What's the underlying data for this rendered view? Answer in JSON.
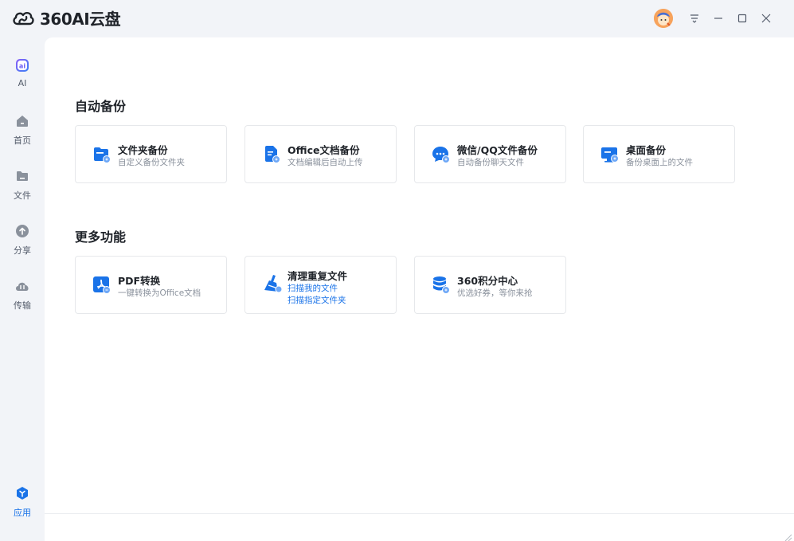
{
  "app": {
    "title": "360AI云盘"
  },
  "sidebar": {
    "items": [
      {
        "label": "AI",
        "icon": "ai-icon"
      },
      {
        "label": "首页",
        "icon": "home-icon"
      },
      {
        "label": "文件",
        "icon": "folder-icon"
      },
      {
        "label": "分享",
        "icon": "share-icon"
      },
      {
        "label": "传输",
        "icon": "transfer-icon"
      }
    ],
    "bottom_item": {
      "label": "应用",
      "icon": "apps-icon"
    }
  },
  "sections": {
    "backup": {
      "title": "自动备份",
      "cards": [
        {
          "title": "文件夹备份",
          "sub": "自定义备份文件夹",
          "icon": "folder-backup-icon"
        },
        {
          "title": "Office文档备份",
          "sub": "文档编辑后自动上传",
          "icon": "office-doc-icon"
        },
        {
          "title": "微信/QQ文件备份",
          "sub": "自动备份聊天文件",
          "icon": "chat-backup-icon"
        },
        {
          "title": "桌面备份",
          "sub": "备份桌面上的文件",
          "icon": "desktop-backup-icon"
        }
      ]
    },
    "more": {
      "title": "更多功能",
      "cards": [
        {
          "title": "PDF转换",
          "sub": "一键转换为Office文档",
          "icon": "pdf-convert-icon"
        },
        {
          "title": "清理重复文件",
          "links": [
            "扫描我的文件",
            "扫描指定文件夹"
          ],
          "icon": "broom-icon"
        },
        {
          "title": "360积分中心",
          "sub": "优选好券，等你来抢",
          "icon": "coin-stack-icon"
        }
      ]
    }
  },
  "colors": {
    "accent": "#1a73e8",
    "sidebar_bg": "#f2f4f8",
    "icon_gray": "#8a919c"
  }
}
